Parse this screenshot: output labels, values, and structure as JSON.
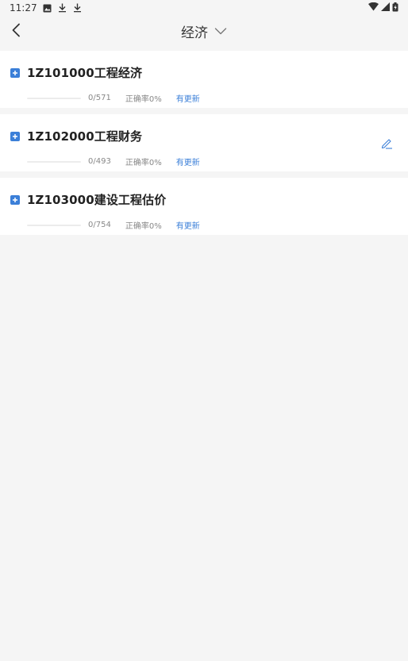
{
  "status_bar": {
    "time": "11:27",
    "left_icons": [
      "photo-icon",
      "download-icon",
      "download-icon"
    ],
    "right_icons": [
      "wifi-icon",
      "signal-icon",
      "battery-icon"
    ]
  },
  "nav": {
    "title": "经济",
    "back_icon": "back-arrow-icon",
    "dropdown_icon": "chevron-down-icon"
  },
  "chapters": [
    {
      "title": "1Z101000工程经济",
      "count": "0/571",
      "accuracy": "正确率0%",
      "update": "有更新",
      "progress": 0,
      "editable": false
    },
    {
      "title": "1Z102000工程财务",
      "count": "0/493",
      "accuracy": "正确率0%",
      "update": "有更新",
      "progress": 0,
      "editable": true
    },
    {
      "title": "1Z103000建设工程估价",
      "count": "0/754",
      "accuracy": "正确率0%",
      "update": "有更新",
      "progress": 0,
      "editable": false
    }
  ],
  "colors": {
    "accent": "#3b7fd8",
    "background": "#f5f5f5",
    "card": "#ffffff"
  }
}
